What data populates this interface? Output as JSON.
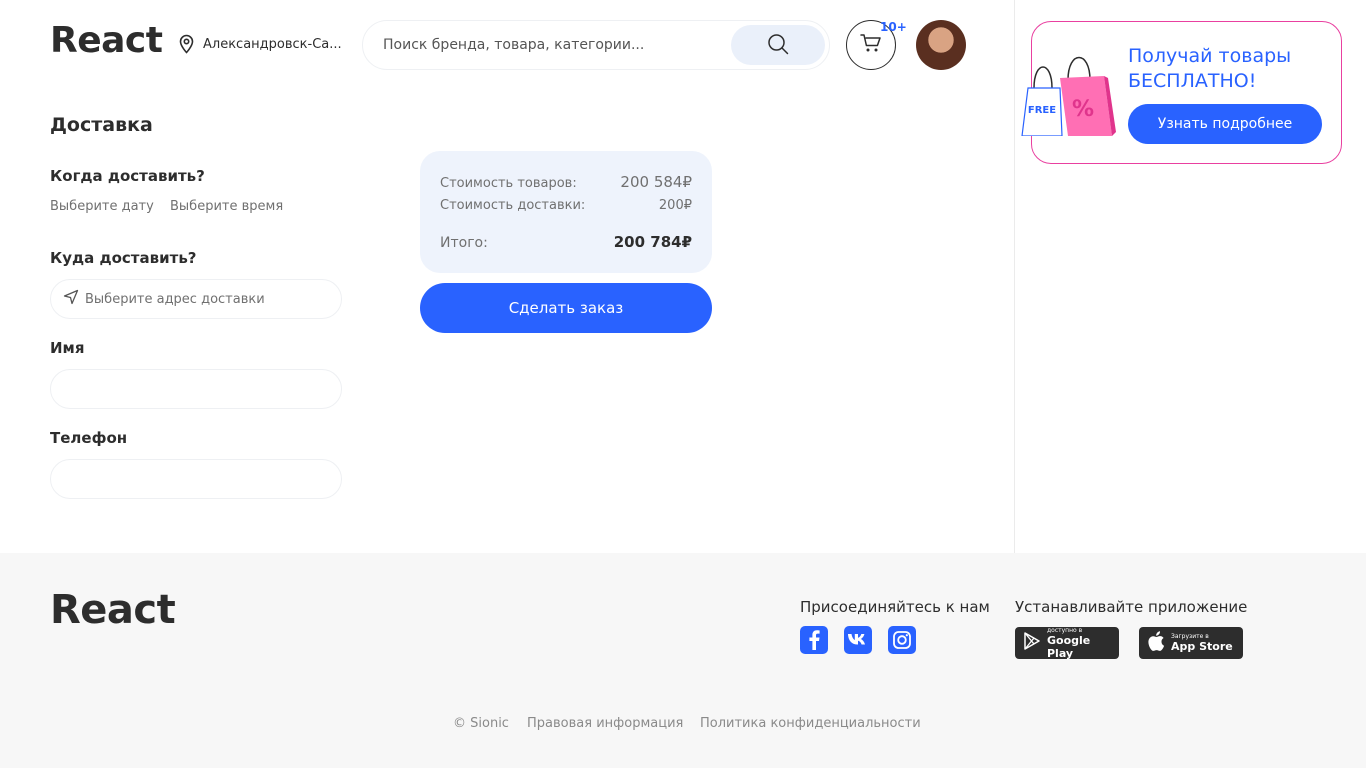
{
  "header": {
    "logo": "React",
    "location": "Александровск-Са...",
    "search_placeholder": "Поиск бренда, товара, категории...",
    "cart_badge": "10+"
  },
  "promo": {
    "title": "Получай товары БЕСПЛАТНО!",
    "button": "Узнать подробнее",
    "bag_free_label": "FREE",
    "bag_percent_label": "%"
  },
  "delivery": {
    "title": "Доставка",
    "when_label": "Когда доставить?",
    "pick_date": "Выберите дату",
    "pick_time": "Выберите время",
    "where_label": "Куда доставить?",
    "address_placeholder": "Выберите адрес доставки",
    "name_label": "Имя",
    "name_value": "",
    "phone_label": "Телефон",
    "phone_value": ""
  },
  "summary": {
    "goods_label": "Стоимость товаров:",
    "goods_value": "200 584₽",
    "delivery_label": "Стоимость доставки:",
    "delivery_value": "200₽",
    "total_label": "Итого:",
    "total_value": "200 784₽",
    "order_button": "Сделать заказ"
  },
  "footer": {
    "logo": "React",
    "join_label": "Присоединяйтесь к нам",
    "app_label": "Устанавливайте приложение",
    "social_icons": [
      "facebook-icon",
      "vk-icon",
      "instagram-icon"
    ],
    "google_play_small": "доступно в",
    "google_play_big": "Google Play",
    "app_store_small": "Загрузите в",
    "app_store_big": "App Store",
    "copyright": "© Sionic",
    "legal": "Правовая информация",
    "privacy": "Политика конфиденциальности"
  },
  "colors": {
    "accent": "#2962ff",
    "promo_border": "#e940a0",
    "text": "#2d2d2d",
    "muted": "#707070",
    "summary_bg": "#eef3fc",
    "footer_bg": "#f7f7f7"
  }
}
